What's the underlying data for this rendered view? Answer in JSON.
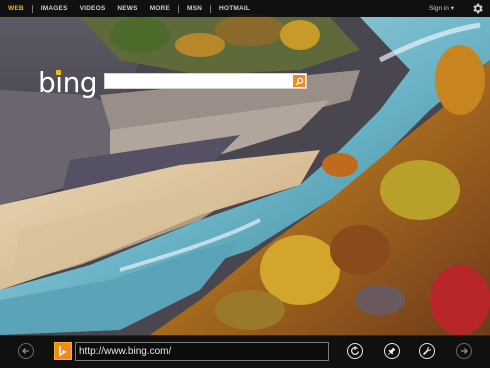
{
  "nav": {
    "items": [
      {
        "label": "WEB"
      },
      {
        "label": "IMAGES"
      },
      {
        "label": "VIDEOS"
      },
      {
        "label": "NEWS"
      },
      {
        "label": "MORE"
      },
      {
        "label": "MSN"
      },
      {
        "label": "HOTMAIL"
      }
    ],
    "signin": "Sign in ▾"
  },
  "logo": {
    "text": "bing"
  },
  "search": {
    "value": "",
    "placeholder": ""
  },
  "appbar": {
    "address": "http://www.bing.com/"
  },
  "colors": {
    "accent": "#f5b51a",
    "search_button": "#f08a1e",
    "bar_bg": "#101010"
  },
  "icons": [
    "gear-icon",
    "search-icon",
    "back-icon",
    "bing-tab-icon",
    "refresh-icon",
    "pin-icon",
    "tools-icon",
    "forward-icon"
  ]
}
